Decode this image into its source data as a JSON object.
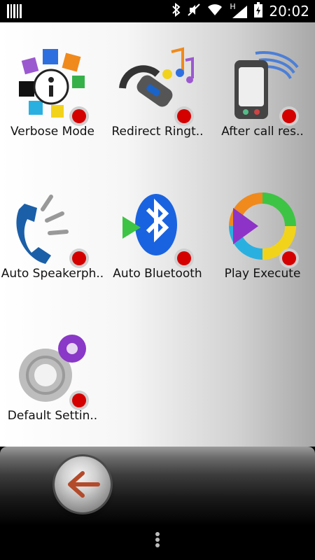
{
  "status_bar": {
    "time": "20:02",
    "network_type": "H",
    "icons": [
      "barcode-icon",
      "bluetooth-icon",
      "mute-icon",
      "wifi-icon",
      "signal-icon",
      "battery-charging-icon"
    ]
  },
  "grid": {
    "items": [
      {
        "label": "Verbose Mode",
        "icon": "info-color-wheel-icon"
      },
      {
        "label": "Redirect Ringt..",
        "icon": "headset-music-icon"
      },
      {
        "label": "After call res..",
        "icon": "phone-signal-icon"
      },
      {
        "label": "Auto Speakerph..",
        "icon": "phone-speaker-icon"
      },
      {
        "label": "Auto Bluetooth",
        "icon": "bluetooth-play-icon"
      },
      {
        "label": "Play Execute",
        "icon": "play-ring-icon"
      },
      {
        "label": "Default Settin..",
        "icon": "gears-icon"
      }
    ]
  },
  "bottom_bar": {
    "back_icon": "back-arrow-icon",
    "menu_icon": "overflow-menu-icon"
  },
  "colors": {
    "status_dot": "#d40000",
    "back_arrow": "#b34a2a"
  }
}
